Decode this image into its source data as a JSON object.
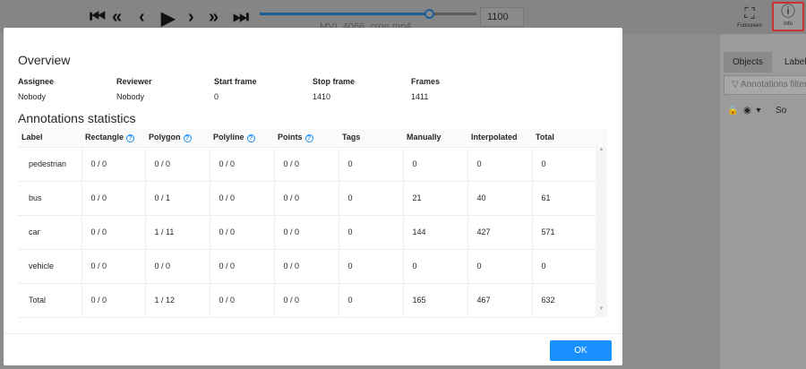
{
  "player": {
    "frame": "1100",
    "filename": "MVI_4066_crop.mp4",
    "progress": 0.78
  },
  "toolbar": {
    "fullscreen": "Fullscreen",
    "info": "Info"
  },
  "right_panel": {
    "tabs": [
      "Objects",
      "Labels"
    ],
    "filter_placeholder": "Annotations filter",
    "sort": "So"
  },
  "modal": {
    "overview_title": "Overview",
    "overview": [
      {
        "label": "Assignee",
        "value": "Nobody"
      },
      {
        "label": "Reviewer",
        "value": "Nobody"
      },
      {
        "label": "Start frame",
        "value": "0"
      },
      {
        "label": "Stop frame",
        "value": "1410"
      },
      {
        "label": "Frames",
        "value": "1411"
      }
    ],
    "stats_title": "Annotations statistics",
    "columns": [
      "Label",
      "Rectangle",
      "Polygon",
      "Polyline",
      "Points",
      "Tags",
      "Manually",
      "Interpolated",
      "Total"
    ],
    "rows": [
      [
        "pedestrian",
        "0 / 0",
        "0 / 0",
        "0 / 0",
        "0 / 0",
        "0",
        "0",
        "0",
        "0"
      ],
      [
        "bus",
        "0 / 0",
        "0 / 1",
        "0 / 0",
        "0 / 0",
        "0",
        "21",
        "40",
        "61"
      ],
      [
        "car",
        "0 / 0",
        "1 / 11",
        "0 / 0",
        "0 / 0",
        "0",
        "144",
        "427",
        "571"
      ],
      [
        "vehicle",
        "0 / 0",
        "0 / 0",
        "0 / 0",
        "0 / 0",
        "0",
        "0",
        "0",
        "0"
      ],
      [
        "Total",
        "0 / 0",
        "1 / 12",
        "0 / 0",
        "0 / 0",
        "0",
        "165",
        "467",
        "632"
      ]
    ],
    "ok_label": "OK"
  }
}
